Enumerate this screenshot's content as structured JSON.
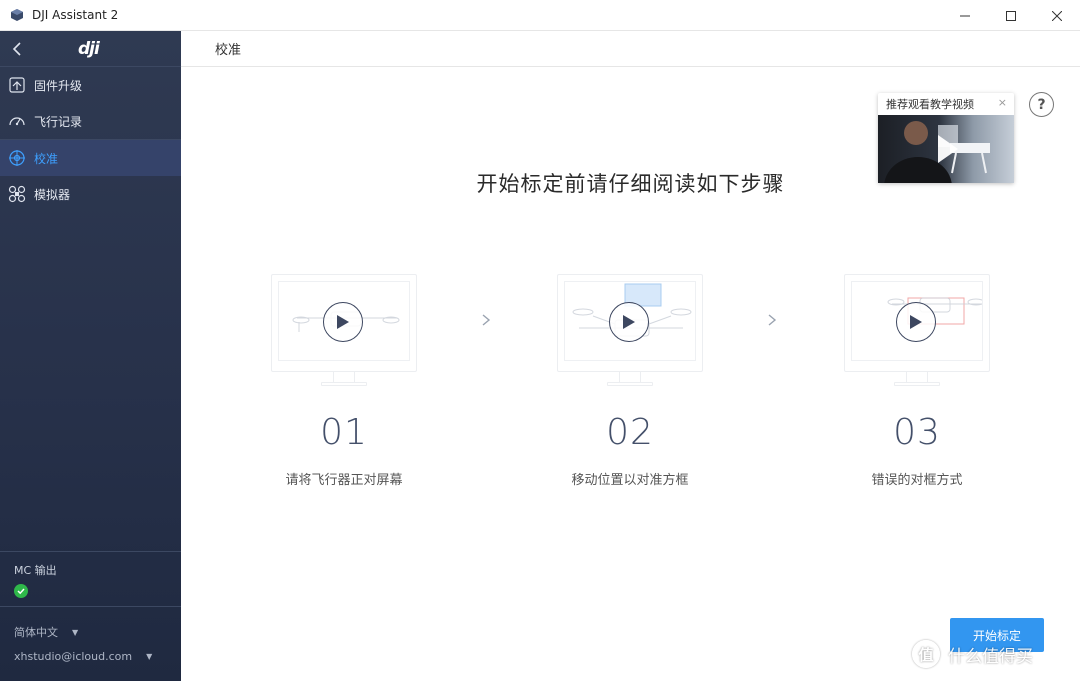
{
  "window": {
    "title": "DJI Assistant 2",
    "controls": [
      "minimize",
      "maximize",
      "close"
    ]
  },
  "sidebar": {
    "logo": "dji",
    "items": [
      {
        "label": "固件升级",
        "icon": "firmware-icon",
        "active": false
      },
      {
        "label": "飞行记录",
        "icon": "gauge-icon",
        "active": false
      },
      {
        "label": "校准",
        "icon": "compass-icon",
        "active": true
      },
      {
        "label": "模拟器",
        "icon": "drone-icon",
        "active": false
      }
    ],
    "mc_output": {
      "label": "MC 输出",
      "status": "ok"
    },
    "language": "简体中文",
    "account": "xhstudio@icloud.com"
  },
  "main": {
    "section_title": "校准",
    "headline": "开始标定前请仔细阅读如下步骤",
    "tutorial": {
      "label": "推荐观看教学视频",
      "close": "×"
    },
    "help": "?",
    "steps": [
      {
        "number": "01",
        "caption": "请将飞行器正对屏幕"
      },
      {
        "number": "02",
        "caption": "移动位置以对准方框"
      },
      {
        "number": "03",
        "caption": "错误的对框方式"
      }
    ],
    "start_button": "开始标定"
  },
  "watermark": {
    "logo": "值",
    "text": "什么值得买"
  },
  "colors": {
    "sidebar_bg": "#27314a",
    "active_blue": "#3ea0ff",
    "button_blue": "#3296f0",
    "status_green": "#2fb84a"
  }
}
